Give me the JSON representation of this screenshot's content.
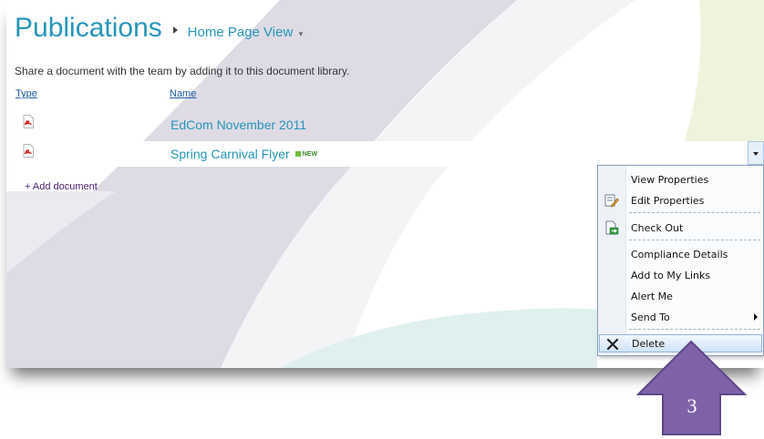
{
  "page": {
    "title": "Publications",
    "view_label": "Home Page View",
    "description": "Share a document with the team by adding it to this document library."
  },
  "columns": {
    "type": "Type",
    "name": "Name"
  },
  "documents": [
    {
      "name": "EdCom November 2011",
      "icon": "pdf-icon",
      "is_new": false
    },
    {
      "name": "Spring Carnival Flyer",
      "icon": "pdf-icon",
      "is_new": true,
      "new_badge": "NEW"
    }
  ],
  "add_document": "+ Add document",
  "context_menu": {
    "items": [
      {
        "label": "View Properties",
        "icon": ""
      },
      {
        "label": "Edit Properties",
        "icon": "edit-properties-icon"
      },
      {
        "label": "Check Out",
        "icon": "check-out-icon"
      },
      {
        "label": "Compliance Details",
        "icon": ""
      },
      {
        "label": "Add to My Links",
        "icon": ""
      },
      {
        "label": "Alert Me",
        "icon": ""
      },
      {
        "label": "Send To",
        "icon": "",
        "submenu": true
      },
      {
        "label": "Delete",
        "icon": "delete-x-icon",
        "highlighted": true
      }
    ]
  },
  "callout": {
    "step_number": "3",
    "color": "#7e62a8"
  },
  "colors": {
    "accent": "#2596b8",
    "link": "#1b5aa3",
    "add_link": "#4b2270"
  }
}
